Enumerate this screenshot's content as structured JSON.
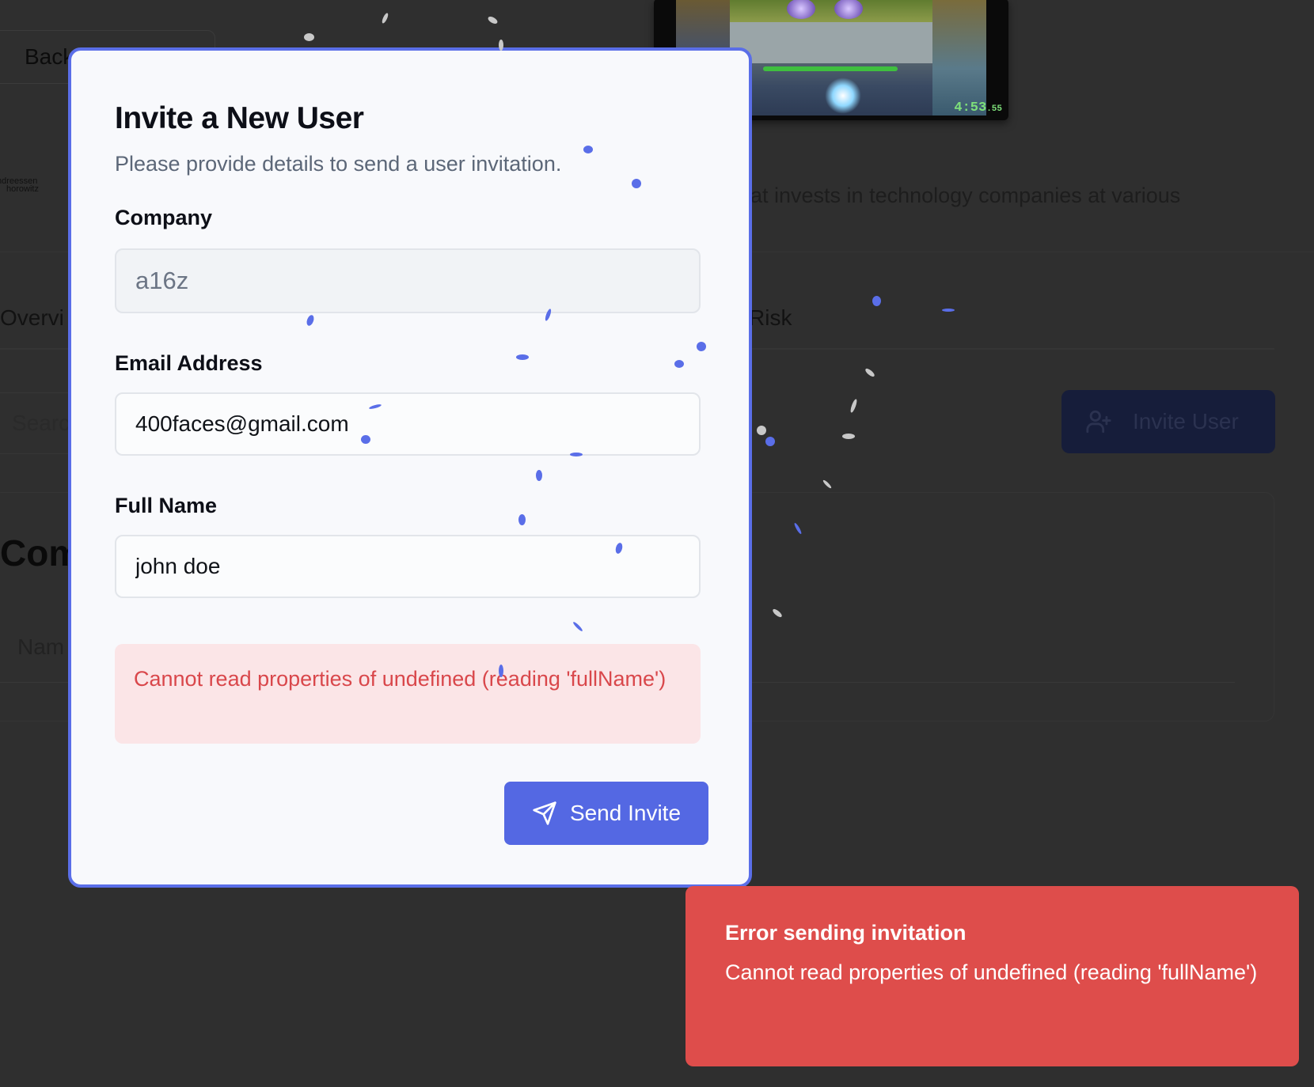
{
  "background": {
    "back_label": "Back",
    "logo_line1": "ndreessen",
    "logo_line2": "horowitz",
    "description": "at invests in technology companies at various",
    "tab_overview": "Overvi",
    "tab_risk": "Risk",
    "search_placeholder": "Searc",
    "invite_user_label": "Invite User",
    "card_title": "Com",
    "name_column": "Nam"
  },
  "video": {
    "time_main": "4:53",
    "time_fraction": ".55"
  },
  "modal": {
    "title": "Invite a New User",
    "subtitle": "Please provide details to send a user invitation.",
    "company": {
      "label": "Company",
      "value": "a16z"
    },
    "email": {
      "label": "Email Address",
      "value": "400faces@gmail.com"
    },
    "full_name": {
      "label": "Full Name",
      "value": "john doe"
    },
    "error_message": "Cannot read properties of undefined (reading 'fullName')",
    "send_label": "Send Invite"
  },
  "toast": {
    "title": "Error sending invitation",
    "message": "Cannot read properties of undefined (reading 'fullName')"
  },
  "colors": {
    "accent": "#5468e3",
    "modal_border": "#5a6ee8",
    "error_bg": "#fbe5e7",
    "error_text": "#d9474b",
    "toast_bg": "#de4d4b",
    "backdrop": "#2f2f2f"
  },
  "icons": {
    "send_button": "send-icon",
    "invite_user_button": "user-plus-icon"
  }
}
